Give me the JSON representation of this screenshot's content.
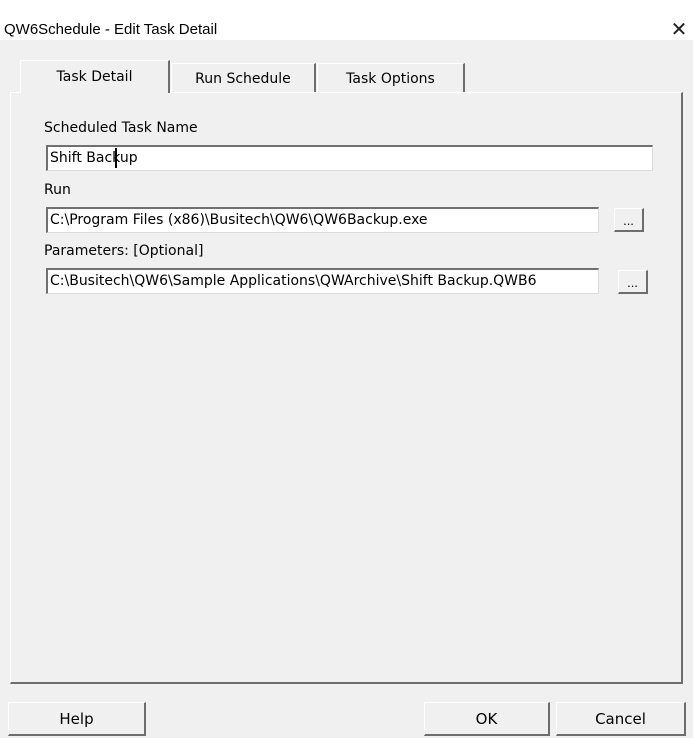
{
  "window": {
    "title": "QW6Schedule - Edit Task Detail",
    "close_glyph": "✕"
  },
  "tabs": [
    {
      "label": "Task Detail",
      "active": true
    },
    {
      "label": "Run Schedule",
      "active": false
    },
    {
      "label": "Task Options",
      "active": false
    }
  ],
  "form": {
    "task_name_label": "Scheduled Task Name",
    "task_name_value": "Shift Backup",
    "run_label": "Run",
    "run_value": "C:\\Program Files (x86)\\Busitech\\QW6\\QW6Backup.exe",
    "run_browse": "...",
    "params_label": "Parameters: [Optional]",
    "params_value": "C:\\Busitech\\QW6\\Sample Applications\\QWArchive\\Shift Backup.QWB6",
    "params_browse": "..."
  },
  "buttons": {
    "help": "Help",
    "ok": "OK",
    "cancel": "Cancel"
  },
  "icons": {
    "close": "close-icon"
  }
}
